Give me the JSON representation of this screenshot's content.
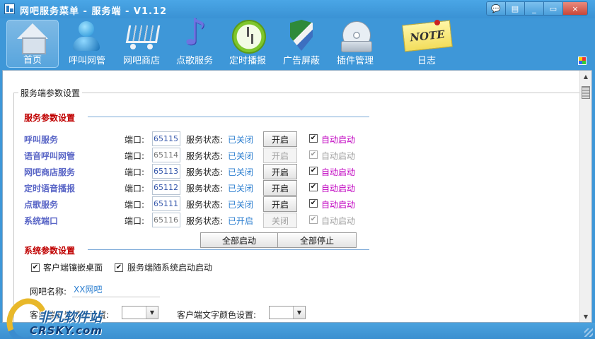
{
  "window": {
    "title": "网吧服务菜单 - 服务端 - V1.12",
    "controls": [
      "💬",
      "▤",
      "▭",
      "×"
    ]
  },
  "toolbar": {
    "items": [
      {
        "label": "首页",
        "icon": "home-icon"
      },
      {
        "label": "呼叫网管",
        "icon": "person-icon"
      },
      {
        "label": "网吧商店",
        "icon": "cart-icon"
      },
      {
        "label": "点歌服务",
        "icon": "music-note-icon"
      },
      {
        "label": "定时播报",
        "icon": "clock-icon"
      },
      {
        "label": "广告屏蔽",
        "icon": "shield-icon"
      },
      {
        "label": "插件管理",
        "icon": "disc-icon"
      },
      {
        "label": "日志",
        "icon": "notepad-icon"
      }
    ],
    "notepad_text": "NOTE"
  },
  "settings": {
    "group_title": "服务端参数设置",
    "service_section": "服务参数设置",
    "port_label": "端口:",
    "status_label": "服务状态:",
    "services": [
      {
        "name": "呼叫服务",
        "port": "65115",
        "status": "已关闭",
        "action": "开启",
        "auto": "自动启动"
      },
      {
        "name": "语音呼叫网管",
        "port": "65114",
        "status": "已关闭",
        "action": "开启",
        "auto": "自动启动"
      },
      {
        "name": "网吧商店服务",
        "port": "65113",
        "status": "已关闭",
        "action": "开启",
        "auto": "自动启动"
      },
      {
        "name": "定时语音播报",
        "port": "65112",
        "status": "已关闭",
        "action": "开启",
        "auto": "自动启动"
      },
      {
        "name": "点歌服务",
        "port": "65111",
        "status": "已关闭",
        "action": "开启",
        "auto": "自动启动"
      },
      {
        "name": "系统端口",
        "port": "65116",
        "status": "已开启",
        "action": "关闭",
        "auto": "自动启动"
      }
    ],
    "start_all": "全部启动",
    "stop_all": "全部停止",
    "system_section": "系统参数设置",
    "embed_desktop": "客户端镶嵌桌面",
    "autostart_with_system": "服务端随系统启动启动",
    "cafe_name_label": "网吧名称:",
    "cafe_name_value": "XX网吧",
    "client_bg_color_label": "客户端背景颜色设置:",
    "client_text_color_label": "客户端文字颜色设置:"
  },
  "watermark": {
    "line1": "非凡软件站",
    "line2": "CRSKY.com"
  }
}
